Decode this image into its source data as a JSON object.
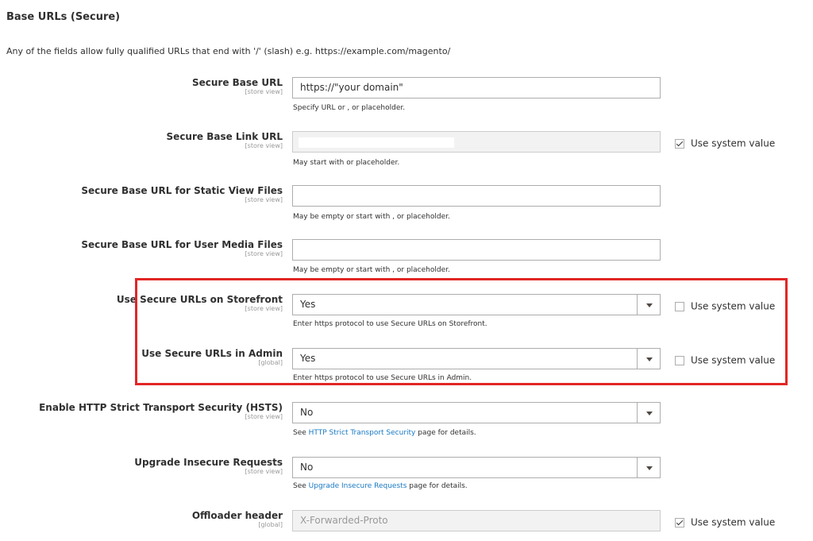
{
  "section": {
    "title": "Base URLs (Secure)",
    "note": "Any of the fields allow fully qualified URLs that end with '/' (slash) e.g. https://example.com/magento/"
  },
  "system_value_label": "Use system value",
  "fields": {
    "secure_base_url": {
      "label": "Secure Base URL",
      "scope": "[store view]",
      "value": "https://\"your domain\"",
      "note": "Specify URL or , or placeholder."
    },
    "secure_base_link_url": {
      "label": "Secure Base Link URL",
      "scope": "[store view]",
      "value": "",
      "note": "May start with or placeholder.",
      "use_system_value": true
    },
    "secure_static_url": {
      "label": "Secure Base URL for Static View Files",
      "scope": "[store view]",
      "value": "",
      "note": "May be empty or start with , or placeholder."
    },
    "secure_media_url": {
      "label": "Secure Base URL for User Media Files",
      "scope": "[store view]",
      "value": "",
      "note": "May be empty or start with , or placeholder."
    },
    "use_secure_frontend": {
      "label": "Use Secure URLs on Storefront",
      "scope": "[store view]",
      "value": "Yes",
      "note": "Enter https protocol to use Secure URLs on Storefront.",
      "use_system_value": false
    },
    "use_secure_admin": {
      "label": "Use Secure URLs in Admin",
      "scope": "[global]",
      "value": "Yes",
      "note": "Enter https protocol to use Secure URLs in Admin.",
      "use_system_value": false
    },
    "hsts": {
      "label": "Enable HTTP Strict Transport Security (HSTS)",
      "scope": "[store view]",
      "value": "No",
      "note_prefix": "See ",
      "note_link": "HTTP Strict Transport Security",
      "note_suffix": " page for details."
    },
    "upgrade_insecure": {
      "label": "Upgrade Insecure Requests",
      "scope": "[store view]",
      "value": "No",
      "note_prefix": "See ",
      "note_link": "Upgrade Insecure Requests",
      "note_suffix": " page for details."
    },
    "offloader_header": {
      "label": "Offloader header",
      "scope": "[global]",
      "value": "X-Forwarded-Proto",
      "use_system_value": true
    }
  },
  "colors": {
    "highlight": "#e22626",
    "link": "#1979c3"
  }
}
